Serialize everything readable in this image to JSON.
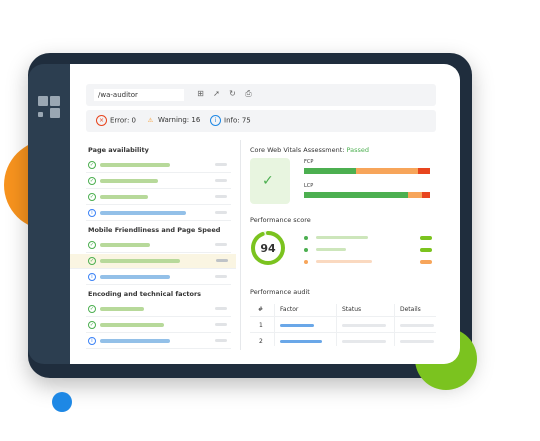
{
  "toolbar": {
    "url": "/wa-auditor",
    "icons": [
      "add-icon",
      "share-icon",
      "refresh-icon",
      "export-icon"
    ]
  },
  "status": {
    "error": "Error: 0",
    "warning": "Warning: 16",
    "info": "Info: 75"
  },
  "left": {
    "sections": [
      {
        "title": "Page availability"
      },
      {
        "title": "Mobile Friendliness and Page Speed"
      },
      {
        "title": "Encoding and technical factors"
      }
    ]
  },
  "cwv": {
    "title": "Core Web Vitals Assessment:",
    "result": "Passed",
    "fcp_label": "FCP",
    "lcp_label": "LCP"
  },
  "performance": {
    "title": "Performance score",
    "score": "94",
    "score_fraction": 0.94
  },
  "audit": {
    "title": "Performance audit",
    "headers": [
      "#",
      "Factor",
      "Status",
      "Details"
    ],
    "rows": [
      "1",
      "2"
    ]
  },
  "colors": {
    "green": "#4caf50",
    "orange": "#f7931e",
    "blue": "#1e88e5",
    "red": "#e8451e"
  }
}
